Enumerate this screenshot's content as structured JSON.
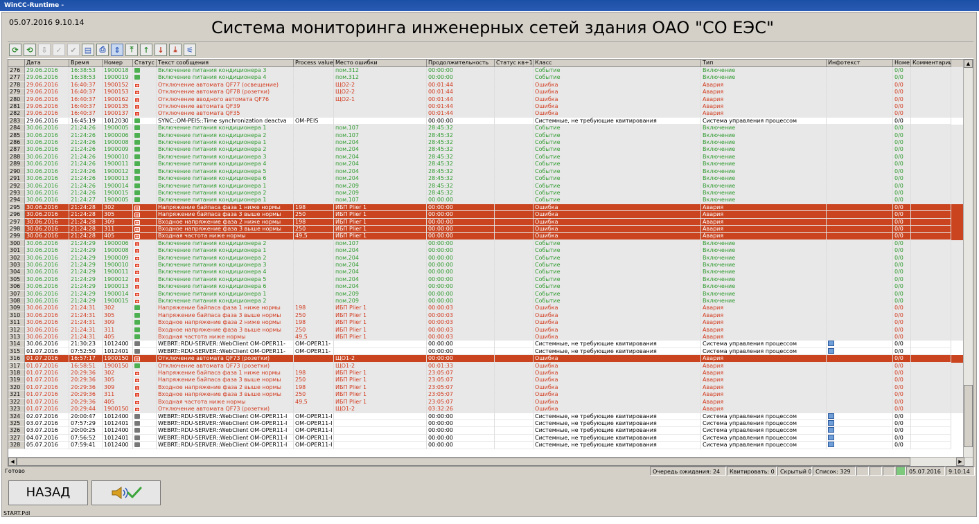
{
  "window_title": "WinCC-Runtime -",
  "datetime": "05.07.2016 9.10.14",
  "main_title": "Система мониторинга инженерных сетей здания ОАО \"СО ЕЭС\"",
  "toolbar_icons": [
    "refresh-icon",
    "refresh-all-icon",
    "arrow-down-icon",
    "acknowledge-icon",
    "acknowledge-all-icon",
    "export-icon",
    "print-icon",
    "autoscroll-icon",
    "first-message-icon",
    "previous-message-icon",
    "next-message-icon",
    "last-message-icon",
    "filter-icon"
  ],
  "columns": [
    "",
    "Дата",
    "Время",
    "Номер",
    "Статус",
    "Текст сообщения",
    "Process value",
    "Место ошибки",
    "Продолжительность",
    "Статус кв+1",
    "Класс",
    "Тип",
    "Инфотекст",
    "Номе",
    "Комментарии"
  ],
  "rows": [
    {
      "n": "276",
      "kind": "event",
      "d": "29.06.2016",
      "t": "16:38:53",
      "num": "1900018",
      "st": "g",
      "text": "Включение питания кондиционера 3",
      "pv": "",
      "place": "пом.312",
      "dur": "00:00:00",
      "cls": "Событие",
      "type": "Включение",
      "info": "",
      "no": "0/0"
    },
    {
      "n": "277",
      "kind": "event",
      "d": "29.06.2016",
      "t": "16:38:53",
      "num": "1900019",
      "st": "g",
      "text": "Включение питания кондиционера 4",
      "pv": "",
      "place": "пом.312",
      "dur": "00:00:00",
      "cls": "Событие",
      "type": "Включение",
      "info": "",
      "no": "0/0"
    },
    {
      "n": "278",
      "kind": "error",
      "d": "29.06.2016",
      "t": "16:40:37",
      "num": "1900152",
      "st": "r",
      "text": "Отключение автомата QF77 (освещение)",
      "pv": "",
      "place": "ЩО2-2",
      "dur": "00:01:44",
      "cls": "Ошибка",
      "type": "Авария",
      "info": "",
      "no": "0/0"
    },
    {
      "n": "279",
      "kind": "error",
      "d": "29.06.2016",
      "t": "16:40:37",
      "num": "1900153",
      "st": "r",
      "text": "Отключение автомата QF78 (розетки)",
      "pv": "",
      "place": "ЩО2-2",
      "dur": "00:01:44",
      "cls": "Ошибка",
      "type": "Авария",
      "info": "",
      "no": "0/0"
    },
    {
      "n": "280",
      "kind": "error",
      "d": "29.06.2016",
      "t": "16:40:37",
      "num": "1900162",
      "st": "r",
      "text": "Отключение вводного автомата QF76",
      "pv": "",
      "place": "ЩО2-1",
      "dur": "00:01:44",
      "cls": "Ошибка",
      "type": "Авария",
      "info": "",
      "no": "0/0"
    },
    {
      "n": "281",
      "kind": "error",
      "d": "29.06.2016",
      "t": "16:40:37",
      "num": "1900135",
      "st": "r",
      "text": "Отключение автомата QF39",
      "pv": "",
      "place": "",
      "dur": "00:01:44",
      "cls": "Ошибка",
      "type": "Авария",
      "info": "",
      "no": "0/0"
    },
    {
      "n": "282",
      "kind": "error",
      "d": "29.06.2016",
      "t": "16:40:37",
      "num": "1900137",
      "st": "r",
      "text": "Отключение автомата QF35",
      "pv": "",
      "place": "",
      "dur": "00:01:44",
      "cls": "Ошибка",
      "type": "Авария",
      "info": "",
      "no": "0/0"
    },
    {
      "n": "283",
      "kind": "system",
      "d": "29.06.2016",
      "t": "16:45:19",
      "num": "1012030",
      "st": "g",
      "text": "SYNC::OM-PEIS::Time synchronization deactva",
      "pv": "OM-PEIS",
      "place": "",
      "dur": "00:00:00",
      "cls": "Системные, не требующие квитирования",
      "type": "Система управления процессом",
      "info": "",
      "no": "0/0"
    },
    {
      "n": "284",
      "kind": "event",
      "d": "30.06.2016",
      "t": "21:24:26",
      "num": "1900005",
      "st": "g",
      "text": "Включение питания кондиционера 1",
      "pv": "",
      "place": "пом.107",
      "dur": "28:45:32",
      "cls": "Событие",
      "type": "Включение",
      "info": "",
      "no": "0/0"
    },
    {
      "n": "285",
      "kind": "event",
      "d": "30.06.2016",
      "t": "21:24:26",
      "num": "1900006",
      "st": "g",
      "text": "Включение питания кондиционера 2",
      "pv": "",
      "place": "пом.107",
      "dur": "28:45:32",
      "cls": "Событие",
      "type": "Включение",
      "info": "",
      "no": "0/0"
    },
    {
      "n": "286",
      "kind": "event",
      "d": "30.06.2016",
      "t": "21:24:26",
      "num": "1900008",
      "st": "g",
      "text": "Включение питания кондиционера 1",
      "pv": "",
      "place": "пом.204",
      "dur": "28:45:32",
      "cls": "Событие",
      "type": "Включение",
      "info": "",
      "no": "0/0"
    },
    {
      "n": "287",
      "kind": "event",
      "d": "30.06.2016",
      "t": "21:24:26",
      "num": "1900009",
      "st": "g",
      "text": "Включение питания кондиционера 2",
      "pv": "",
      "place": "пом.204",
      "dur": "28:45:32",
      "cls": "Событие",
      "type": "Включение",
      "info": "",
      "no": "0/0"
    },
    {
      "n": "288",
      "kind": "event",
      "d": "30.06.2016",
      "t": "21:24:26",
      "num": "1900010",
      "st": "g",
      "text": "Включение питания кондиционера 3",
      "pv": "",
      "place": "пом.204",
      "dur": "28:45:32",
      "cls": "Событие",
      "type": "Включение",
      "info": "",
      "no": "0/0"
    },
    {
      "n": "289",
      "kind": "event",
      "d": "30.06.2016",
      "t": "21:24:26",
      "num": "1900011",
      "st": "g",
      "text": "Включение питания кондиционера 4",
      "pv": "",
      "place": "пом.204",
      "dur": "28:45:32",
      "cls": "Событие",
      "type": "Включение",
      "info": "",
      "no": "0/0"
    },
    {
      "n": "290",
      "kind": "event",
      "d": "30.06.2016",
      "t": "21:24:26",
      "num": "1900012",
      "st": "g",
      "text": "Включение питания кондиционера 5",
      "pv": "",
      "place": "пом.204",
      "dur": "28:45:32",
      "cls": "Событие",
      "type": "Включение",
      "info": "",
      "no": "0/0"
    },
    {
      "n": "291",
      "kind": "event",
      "d": "30.06.2016",
      "t": "21:24:26",
      "num": "1900013",
      "st": "g",
      "text": "Включение питания кондиционера 6",
      "pv": "",
      "place": "пом.204",
      "dur": "28:45:32",
      "cls": "Событие",
      "type": "Включение",
      "info": "",
      "no": "0/0"
    },
    {
      "n": "292",
      "kind": "event",
      "d": "30.06.2016",
      "t": "21:24:26",
      "num": "1900014",
      "st": "g",
      "text": "Включение питания кондиционера 1",
      "pv": "",
      "place": "пом.209",
      "dur": "28:45:32",
      "cls": "Событие",
      "type": "Включение",
      "info": "",
      "no": "0/0"
    },
    {
      "n": "293",
      "kind": "event",
      "d": "30.06.2016",
      "t": "21:24:26",
      "num": "1900015",
      "st": "g",
      "text": "Включение питания кондиционера 2",
      "pv": "",
      "place": "пом.209",
      "dur": "28:45:32",
      "cls": "Событие",
      "type": "Включение",
      "info": "",
      "no": "0/0"
    },
    {
      "n": "294",
      "kind": "event",
      "d": "30.06.2016",
      "t": "21:24:27",
      "num": "1900005",
      "st": "g",
      "text": "Включение питания кондиционера 1",
      "pv": "",
      "place": "пом.107",
      "dur": "00:00:00",
      "cls": "Событие",
      "type": "Включение",
      "info": "",
      "no": "0/0"
    },
    {
      "n": "295",
      "kind": "alarm",
      "d": "30.06.2016",
      "t": "21:24:28",
      "num": "302",
      "st": "r",
      "text": "Напряжение байпаса фаза 1 ниже нормы",
      "pv": "198",
      "place": "ИБП Plier 1",
      "dur": "00:00:00",
      "cls": "Ошибка",
      "type": "Авария",
      "info": "",
      "no": "0/0"
    },
    {
      "n": "296",
      "kind": "alarm",
      "d": "30.06.2016",
      "t": "21:24:28",
      "num": "305",
      "st": "r",
      "text": "Напряжение байпаса фаза 3 выше нормы",
      "pv": "250",
      "place": "ИБП Plier 1",
      "dur": "00:00:00",
      "cls": "Ошибка",
      "type": "Авария",
      "info": "",
      "no": "0/0"
    },
    {
      "n": "297",
      "kind": "alarm",
      "d": "30.06.2016",
      "t": "21:24:28",
      "num": "309",
      "st": "r",
      "text": "Входное напряжение фаза 2 ниже нормы",
      "pv": "198",
      "place": "ИБП Plier 1",
      "dur": "00:00:00",
      "cls": "Ошибка",
      "type": "Авария",
      "info": "",
      "no": "0/0"
    },
    {
      "n": "298",
      "kind": "alarm",
      "d": "30.06.2016",
      "t": "21:24:28",
      "num": "311",
      "st": "r",
      "text": "Входное напряжение фаза 3 выше нормы",
      "pv": "250",
      "place": "ИБП Plier 1",
      "dur": "00:00:00",
      "cls": "Ошибка",
      "type": "Авария",
      "info": "",
      "no": "0/0"
    },
    {
      "n": "299",
      "kind": "alarm",
      "d": "30.06.2016",
      "t": "21:24:28",
      "num": "405",
      "st": "r",
      "text": "Входная частота ниже нормы",
      "pv": "49,5",
      "place": "ИБП Plier 1",
      "dur": "00:00:00",
      "cls": "Ошибка",
      "type": "Авария",
      "info": "",
      "no": "0/0"
    },
    {
      "n": "300",
      "kind": "event",
      "d": "30.06.2016",
      "t": "21:24:29",
      "num": "1900006",
      "st": "r",
      "text": "Включение питания кондиционера 2",
      "pv": "",
      "place": "пом.107",
      "dur": "00:00:00",
      "cls": "Событие",
      "type": "Включение",
      "info": "",
      "no": "0/0"
    },
    {
      "n": "301",
      "kind": "event",
      "d": "30.06.2016",
      "t": "21:24:29",
      "num": "1900008",
      "st": "r",
      "text": "Включение питания кондиционера 1",
      "pv": "",
      "place": "пом.204",
      "dur": "00:00:00",
      "cls": "Событие",
      "type": "Включение",
      "info": "",
      "no": "0/0"
    },
    {
      "n": "302",
      "kind": "event",
      "d": "30.06.2016",
      "t": "21:24:29",
      "num": "1900009",
      "st": "r",
      "text": "Включение питания кондиционера 2",
      "pv": "",
      "place": "пом.204",
      "dur": "00:00:00",
      "cls": "Событие",
      "type": "Включение",
      "info": "",
      "no": "0/0"
    },
    {
      "n": "303",
      "kind": "event",
      "d": "30.06.2016",
      "t": "21:24:29",
      "num": "1900010",
      "st": "r",
      "text": "Включение питания кондиционера 3",
      "pv": "",
      "place": "пом.204",
      "dur": "00:00:00",
      "cls": "Событие",
      "type": "Включение",
      "info": "",
      "no": "0/0"
    },
    {
      "n": "304",
      "kind": "event",
      "d": "30.06.2016",
      "t": "21:24:29",
      "num": "1900011",
      "st": "r",
      "text": "Включение питания кондиционера 4",
      "pv": "",
      "place": "пом.204",
      "dur": "00:00:00",
      "cls": "Событие",
      "type": "Включение",
      "info": "",
      "no": "0/0"
    },
    {
      "n": "305",
      "kind": "event",
      "d": "30.06.2016",
      "t": "21:24:29",
      "num": "1900012",
      "st": "r",
      "text": "Включение питания кондиционера 5",
      "pv": "",
      "place": "пом.204",
      "dur": "00:00:00",
      "cls": "Событие",
      "type": "Включение",
      "info": "",
      "no": "0/0"
    },
    {
      "n": "306",
      "kind": "event",
      "d": "30.06.2016",
      "t": "21:24:29",
      "num": "1900013",
      "st": "r",
      "text": "Включение питания кондиционера 6",
      "pv": "",
      "place": "пом.204",
      "dur": "00:00:00",
      "cls": "Событие",
      "type": "Включение",
      "info": "",
      "no": "0/0"
    },
    {
      "n": "307",
      "kind": "event",
      "d": "30.06.2016",
      "t": "21:24:29",
      "num": "1900014",
      "st": "r",
      "text": "Включение питания кондиционера 1",
      "pv": "",
      "place": "пом.209",
      "dur": "00:00:00",
      "cls": "Событие",
      "type": "Включение",
      "info": "",
      "no": "0/0"
    },
    {
      "n": "308",
      "kind": "event",
      "d": "30.06.2016",
      "t": "21:24:29",
      "num": "1900015",
      "st": "r",
      "text": "Включение питания кондиционера 2",
      "pv": "",
      "place": "пом.209",
      "dur": "00:00:00",
      "cls": "Событие",
      "type": "Включение",
      "info": "",
      "no": "0/0"
    },
    {
      "n": "309",
      "kind": "error",
      "d": "30.06.2016",
      "t": "21:24:31",
      "num": "302",
      "st": "g",
      "text": "Напряжение байпаса фаза 1 ниже нормы",
      "pv": "198",
      "place": "ИБП Plier 1",
      "dur": "00:00:03",
      "cls": "Ошибка",
      "type": "Авария",
      "info": "",
      "no": "0/0"
    },
    {
      "n": "310",
      "kind": "error",
      "d": "30.06.2016",
      "t": "21:24:31",
      "num": "305",
      "st": "g",
      "text": "Напряжение байпаса фаза 3 выше нормы",
      "pv": "250",
      "place": "ИБП Plier 1",
      "dur": "00:00:03",
      "cls": "Ошибка",
      "type": "Авария",
      "info": "",
      "no": "0/0"
    },
    {
      "n": "311",
      "kind": "error",
      "d": "30.06.2016",
      "t": "21:24:31",
      "num": "309",
      "st": "g",
      "text": "Входное напряжение фаза 2 ниже нормы",
      "pv": "198",
      "place": "ИБП Plier 1",
      "dur": "00:00:03",
      "cls": "Ошибка",
      "type": "Авария",
      "info": "",
      "no": "0/0"
    },
    {
      "n": "312",
      "kind": "error",
      "d": "30.06.2016",
      "t": "21:24:31",
      "num": "311",
      "st": "g",
      "text": "Входное напряжение фаза 3 выше нормы",
      "pv": "250",
      "place": "ИБП Plier 1",
      "dur": "00:00:03",
      "cls": "Ошибка",
      "type": "Авария",
      "info": "",
      "no": "0/0"
    },
    {
      "n": "313",
      "kind": "error",
      "d": "30.06.2016",
      "t": "21:24:31",
      "num": "405",
      "st": "g",
      "text": "Входная частота ниже нормы",
      "pv": "49,5",
      "place": "ИБП Plier 1",
      "dur": "00:00:03",
      "cls": "Ошибка",
      "type": "Авария",
      "info": "",
      "no": "0/0"
    },
    {
      "n": "314",
      "kind": "system",
      "d": "30.06.2016",
      "t": "21:30:23",
      "num": "1012400",
      "st": "s",
      "text": "WEBRT::RDU-SERVER::WebClient OM-OPER11-",
      "pv": "OM-OPER11-",
      "place": "",
      "dur": "00:00:00",
      "cls": "Системные, не требующие квитирования",
      "type": "Система управления процессом",
      "info": "i",
      "no": "0/0"
    },
    {
      "n": "315",
      "kind": "system",
      "d": "01.07.2016",
      "t": "07:52:50",
      "num": "1012401",
      "st": "s",
      "text": "WEBRT::RDU-SERVER::WebClient OM-OPER11-",
      "pv": "OM-OPER11-",
      "place": "",
      "dur": "00:00:00",
      "cls": "Системные, не требующие квитирования",
      "type": "Система управления процессом",
      "info": "i",
      "no": "0/0"
    },
    {
      "n": "316",
      "kind": "alarm",
      "d": "01.07.2016",
      "t": "16:57:17",
      "num": "1900150",
      "st": "r",
      "text": "Отключение автомата QF73 (розетки)",
      "pv": "",
      "place": "ЩО1-2",
      "dur": "00:00:00",
      "cls": "Ошибка",
      "type": "Авария",
      "info": "",
      "no": "0/0"
    },
    {
      "n": "317",
      "kind": "error",
      "d": "01.07.2016",
      "t": "16:58:51",
      "num": "1900150",
      "st": "g",
      "text": "Отключение автомата QF73 (розетки)",
      "pv": "",
      "place": "ЩО1-2",
      "dur": "00:01:33",
      "cls": "Ошибка",
      "type": "Авария",
      "info": "",
      "no": "0/0"
    },
    {
      "n": "318",
      "kind": "error",
      "d": "01.07.2016",
      "t": "20:29:36",
      "num": "302",
      "st": "r",
      "text": "Напряжение байпаса фаза 1 ниже нормы",
      "pv": "198",
      "place": "ИБП Plier 1",
      "dur": "23:05:07",
      "cls": "Ошибка",
      "type": "Авария",
      "info": "",
      "no": "0/0"
    },
    {
      "n": "319",
      "kind": "error",
      "d": "01.07.2016",
      "t": "20:29:36",
      "num": "305",
      "st": "r",
      "text": "Напряжение байпаса фаза 3 выше нормы",
      "pv": "250",
      "place": "ИБП Plier 1",
      "dur": "23:05:07",
      "cls": "Ошибка",
      "type": "Авария",
      "info": "",
      "no": "0/0"
    },
    {
      "n": "320",
      "kind": "error",
      "d": "01.07.2016",
      "t": "20:29:36",
      "num": "309",
      "st": "r",
      "text": "Входное напряжение фаза 2 выше нормы",
      "pv": "198",
      "place": "ИБП Plier 1",
      "dur": "23:05:07",
      "cls": "Ошибка",
      "type": "Авария",
      "info": "",
      "no": "0/0"
    },
    {
      "n": "321",
      "kind": "error",
      "d": "01.07.2016",
      "t": "20:29:36",
      "num": "311",
      "st": "r",
      "text": "Входное напряжение фаза 3 выше нормы",
      "pv": "250",
      "place": "ИБП Plier 1",
      "dur": "23:05:07",
      "cls": "Ошибка",
      "type": "Авария",
      "info": "",
      "no": "0/0"
    },
    {
      "n": "322",
      "kind": "error",
      "d": "01.07.2016",
      "t": "20:29:36",
      "num": "405",
      "st": "r",
      "text": "Входная частота ниже нормы",
      "pv": "49,5",
      "place": "ИБП Plier 1",
      "dur": "23:05:07",
      "cls": "Ошибка",
      "type": "Авария",
      "info": "",
      "no": "0/0"
    },
    {
      "n": "323",
      "kind": "error",
      "d": "01.07.2016",
      "t": "20:29:44",
      "num": "1900150",
      "st": "r",
      "text": "Отключение автомата QF73 (розетки)",
      "pv": "",
      "place": "ЩО1-2",
      "dur": "03:32:26",
      "cls": "Ошибка",
      "type": "Авария",
      "info": "",
      "no": "0/0"
    },
    {
      "n": "324",
      "kind": "system",
      "d": "02.07.2016",
      "t": "20:00:47",
      "num": "1012400",
      "st": "s",
      "text": "WEBRT::RDU-SERVER::WebClient OM-OPER11-I",
      "pv": "OM-OPER11-I",
      "place": "",
      "dur": "00:00:00",
      "cls": "Системные, не требующие квитирования",
      "type": "Система управления процессом",
      "info": "i",
      "no": "0/0"
    },
    {
      "n": "325",
      "kind": "system",
      "d": "03.07.2016",
      "t": "07:57:29",
      "num": "1012401",
      "st": "s",
      "text": "WEBRT::RDU-SERVER::WebClient OM-OPER11-I",
      "pv": "OM-OPER11-I",
      "place": "",
      "dur": "00:00:00",
      "cls": "Системные, не требующие квитирования",
      "type": "Система управления процессом",
      "info": "i",
      "no": "0/0"
    },
    {
      "n": "326",
      "kind": "system",
      "d": "03.07.2016",
      "t": "20:00:25",
      "num": "1012400",
      "st": "s",
      "text": "WEBRT::RDU-SERVER::WebClient OM-OPER11-I",
      "pv": "OM-OPER11-I",
      "place": "",
      "dur": "00:00:00",
      "cls": "Системные, не требующие квитирования",
      "type": "Система управления процессом",
      "info": "i",
      "no": "0/0"
    },
    {
      "n": "327",
      "kind": "system",
      "d": "04.07.2016",
      "t": "07:56:52",
      "num": "1012401",
      "st": "s",
      "text": "WEBRT::RDU-SERVER::WebClient OM-OPER11-I",
      "pv": "OM-OPER11-I",
      "place": "",
      "dur": "00:00:00",
      "cls": "Системные, не требующие квитирования",
      "type": "Система управления процессом",
      "info": "i",
      "no": "0/0"
    },
    {
      "n": "328",
      "kind": "system",
      "d": "05.07.2016",
      "t": "07:59:41",
      "num": "1012400",
      "st": "s",
      "text": "WEBRT::RDU-SERVER::WebClient OM-OPER11-I",
      "pv": "OM-OPER11-I",
      "place": "",
      "dur": "00:00:00",
      "cls": "Системные, не требующие квитирования",
      "type": "Система управления процессом",
      "info": "i",
      "no": "0/0"
    }
  ],
  "status": {
    "ready": "Готово",
    "queue": "Очередь ожидания: 24",
    "acknowledged": "Квитировать: 0",
    "hidden": "Скрытый 0",
    "list": "Список: 329",
    "date": "05.07.2016",
    "time": "9:10:14"
  },
  "buttons": {
    "back": "НАЗАД",
    "ack_icon": "horn-check-icon"
  },
  "footer": "START.Pdl"
}
